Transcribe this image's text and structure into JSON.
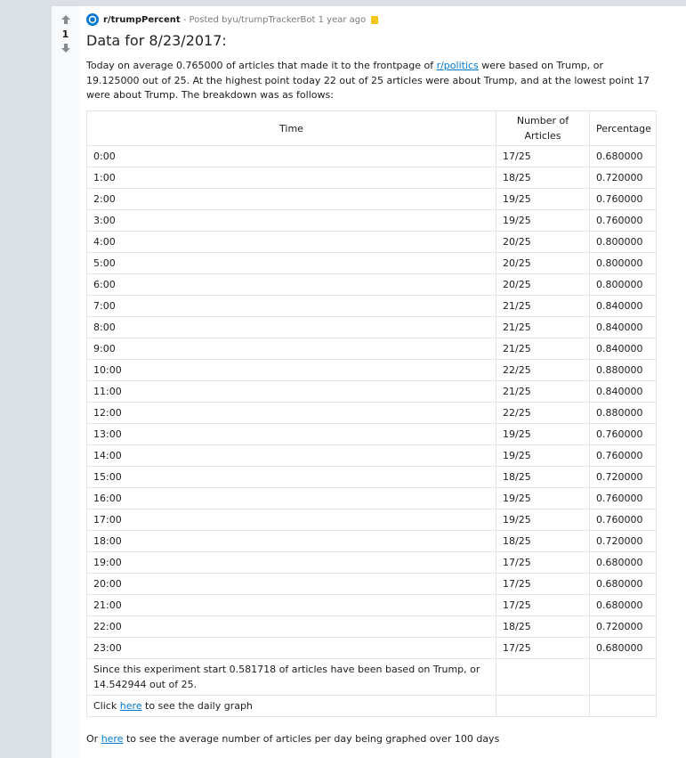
{
  "post": {
    "subreddit": "r/trumpPercent",
    "meta_prefix": " - Posted by ",
    "author": "u/trumpTrackerBot",
    "age": "1 year ago",
    "score": "1",
    "title": "Data for 8/23/2017:",
    "intro": {
      "part1": "Today on average 0.765000 of articles that made it to the frontpage of ",
      "link": "r/politics",
      "part2": " were based on Trump, or 19.125000 out of 25. At the highest point today 22 out of 25 articles were about Trump, and at the lowest point 17 were about Trump. The breakdown was as follows:"
    }
  },
  "table": {
    "headers": [
      "Time",
      "Number of Articles",
      "Percentage"
    ],
    "rows": [
      [
        "0:00",
        "17/25",
        "0.680000"
      ],
      [
        "1:00",
        "18/25",
        "0.720000"
      ],
      [
        "2:00",
        "19/25",
        "0.760000"
      ],
      [
        "3:00",
        "19/25",
        "0.760000"
      ],
      [
        "4:00",
        "20/25",
        "0.800000"
      ],
      [
        "5:00",
        "20/25",
        "0.800000"
      ],
      [
        "6:00",
        "20/25",
        "0.800000"
      ],
      [
        "7:00",
        "21/25",
        "0.840000"
      ],
      [
        "8:00",
        "21/25",
        "0.840000"
      ],
      [
        "9:00",
        "21/25",
        "0.840000"
      ],
      [
        "10:00",
        "22/25",
        "0.880000"
      ],
      [
        "11:00",
        "21/25",
        "0.840000"
      ],
      [
        "12:00",
        "22/25",
        "0.880000"
      ],
      [
        "13:00",
        "19/25",
        "0.760000"
      ],
      [
        "14:00",
        "19/25",
        "0.760000"
      ],
      [
        "15:00",
        "18/25",
        "0.720000"
      ],
      [
        "16:00",
        "19/25",
        "0.760000"
      ],
      [
        "17:00",
        "19/25",
        "0.760000"
      ],
      [
        "18:00",
        "18/25",
        "0.720000"
      ],
      [
        "19:00",
        "17/25",
        "0.680000"
      ],
      [
        "20:00",
        "17/25",
        "0.680000"
      ],
      [
        "21:00",
        "17/25",
        "0.680000"
      ],
      [
        "22:00",
        "18/25",
        "0.720000"
      ],
      [
        "23:00",
        "17/25",
        "0.680000"
      ]
    ],
    "summary": "Since this experiment start 0.581718 of articles have been based on Trump, or 14.542944 out of 25.",
    "daily": {
      "prefix": "Click ",
      "link": "here",
      "suffix": " to see the daily graph"
    }
  },
  "footer": {
    "prefix": "Or ",
    "link": "here",
    "suffix": " to see the average number of articles per day being graphed over 100 days"
  },
  "colors": {
    "page_bg": "#dae0e6",
    "link": "#0079d3",
    "vote_arrow": "#878a8c",
    "award": "#f5c518"
  },
  "icons": {
    "upvote": "upvote-arrow-icon",
    "downvote": "downvote-arrow-icon",
    "subreddit": "subreddit-icon",
    "award": "award-icon"
  }
}
